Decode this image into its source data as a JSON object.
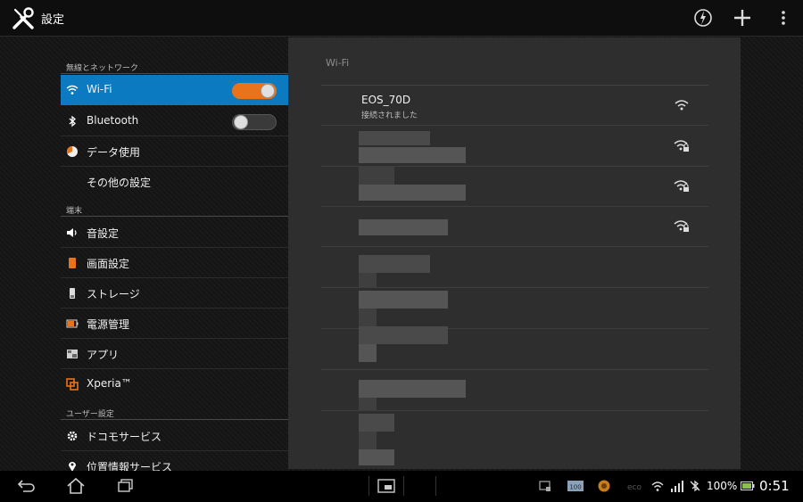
{
  "app": {
    "title": "設定"
  },
  "toolbar": {
    "icons": [
      "wifi-ap-icon",
      "add-icon",
      "overflow-menu-icon"
    ]
  },
  "sections": [
    {
      "header": "無線とネットワーク"
    },
    {
      "header": "端末"
    },
    {
      "header": "ユーザー設定"
    }
  ],
  "items": {
    "wifi": {
      "label": "Wi-Fi",
      "toggle": "on"
    },
    "bluetooth": {
      "label": "Bluetooth",
      "toggle": "off"
    },
    "data_usage": {
      "label": "データ使用"
    },
    "more": {
      "label": "その他の設定"
    },
    "sound": {
      "label": "音設定"
    },
    "display": {
      "label": "画面設定"
    },
    "storage": {
      "label": "ストレージ"
    },
    "power": {
      "label": "電源管理"
    },
    "apps": {
      "label": "アプリ"
    },
    "xperia": {
      "label": "Xperia™"
    },
    "docomo": {
      "label": "ドコモサービス"
    },
    "location": {
      "label": "位置情報サービス"
    }
  },
  "wifi_pane": {
    "title": "Wi-Fi",
    "connected": {
      "ssid": "EOS_70D",
      "status": "接続されました"
    }
  },
  "status_bar": {
    "battery": "100%",
    "time": "0:51"
  },
  "colors": {
    "accent": "#0c7ac0",
    "toggle_on": "#e8731b"
  }
}
